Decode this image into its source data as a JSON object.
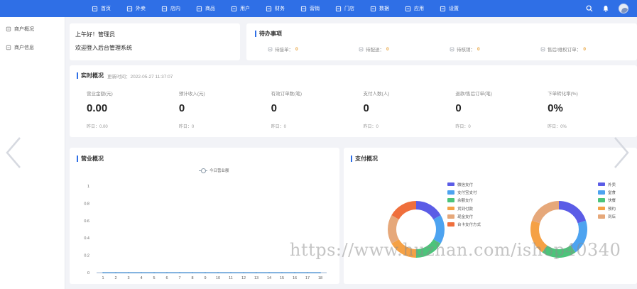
{
  "nav": {
    "items": [
      {
        "icon": "home-icon",
        "label": "首页"
      },
      {
        "icon": "shop-icon",
        "label": "外卖"
      },
      {
        "icon": "dine-in-icon",
        "label": "店内"
      },
      {
        "icon": "goods-icon",
        "label": "商品"
      },
      {
        "icon": "user-icon",
        "label": "用户"
      },
      {
        "icon": "finance-icon",
        "label": "财务"
      },
      {
        "icon": "marketing-icon",
        "label": "营销"
      },
      {
        "icon": "store-icon",
        "label": "门店"
      },
      {
        "icon": "data-icon",
        "label": "数据"
      },
      {
        "icon": "app-icon",
        "label": "应用"
      },
      {
        "icon": "settings-icon",
        "label": "设置"
      }
    ]
  },
  "sidebar": {
    "items": [
      {
        "icon": "overview-icon",
        "label": "商户概况"
      },
      {
        "icon": "info-icon",
        "label": "商户信息"
      }
    ]
  },
  "welcome": {
    "greeting": "上午好！管理员",
    "message": "欢迎登入后台管理系统"
  },
  "todo": {
    "title": "待办事项",
    "items": [
      {
        "label": "待接单：",
        "value": "0"
      },
      {
        "label": "待配送：",
        "value": "0"
      },
      {
        "label": "待核销：",
        "value": "0"
      },
      {
        "label": "售后/维权订单：",
        "value": "0"
      }
    ]
  },
  "realtime": {
    "title": "实时概况",
    "updated": "更新时间：2022-05-27 11:37:07",
    "metrics": [
      {
        "label": "营业金额(元)",
        "value": "0.00",
        "yesterday": "昨日：0.00"
      },
      {
        "label": "预计收入(元)",
        "value": "0",
        "yesterday": "昨日：0"
      },
      {
        "label": "有效订单数(笔)",
        "value": "0",
        "yesterday": "昨日：0"
      },
      {
        "label": "支付人数(人)",
        "value": "0",
        "yesterday": "昨日：0"
      },
      {
        "label": "退款/售后订单(笔)",
        "value": "0",
        "yesterday": "昨日：0"
      },
      {
        "label": "下单转化率(%)",
        "value": "0%",
        "yesterday": "昨日：0%"
      }
    ]
  },
  "business": {
    "title": "营业概况",
    "legend": "今日营业额"
  },
  "payment": {
    "title": "支付概况",
    "legend_methods": [
      "微信支付",
      "支付宝支付",
      "余额支付",
      "货到付款",
      "现金支付",
      "台卡支付方式"
    ],
    "legend_channels": [
      "外卖",
      "堂食",
      "快餐",
      "预约",
      "到店"
    ]
  },
  "colors": {
    "accent": "#2f6fe6",
    "todo_value": "#e8a33d"
  },
  "watermark": "https://www.huzhan.com/ishop40340",
  "chart_data": [
    {
      "type": "line",
      "title": "营业概况",
      "x": [
        1,
        2,
        3,
        4,
        5,
        6,
        7,
        8,
        9,
        10,
        11,
        12,
        13,
        14,
        15,
        16,
        17,
        18
      ],
      "series": [
        {
          "name": "今日营业额",
          "values": [
            0,
            0,
            0,
            0,
            0,
            0,
            0,
            0,
            0,
            0,
            0,
            0,
            0,
            0,
            0,
            0,
            0,
            0
          ],
          "color": "#5b9bd5"
        }
      ],
      "y_ticks": [
        "0",
        "0.2",
        "0.4",
        "0.6",
        "0.8",
        "1"
      ],
      "ylim": [
        0,
        1
      ],
      "grid": false
    },
    {
      "type": "pie",
      "title": "",
      "labels": [
        "微信支付",
        "支付宝支付",
        "余额支付",
        "货到付款",
        "现金支付",
        "台卡支付方式"
      ],
      "values": [
        1,
        1,
        1,
        1,
        1,
        1
      ],
      "colors": [
        "#5b5ce6",
        "#4da3f0",
        "#4cc47a",
        "#f5a145",
        "#e6a87a",
        "#ef6f3c"
      ]
    },
    {
      "type": "pie",
      "title": "",
      "labels": [
        "外卖",
        "堂食",
        "快餐",
        "预约",
        "到店"
      ],
      "values": [
        1,
        1,
        1,
        1,
        1
      ],
      "colors": [
        "#5b5ce6",
        "#4da3f0",
        "#4cc47a",
        "#f5a145",
        "#e6a87a"
      ]
    }
  ]
}
